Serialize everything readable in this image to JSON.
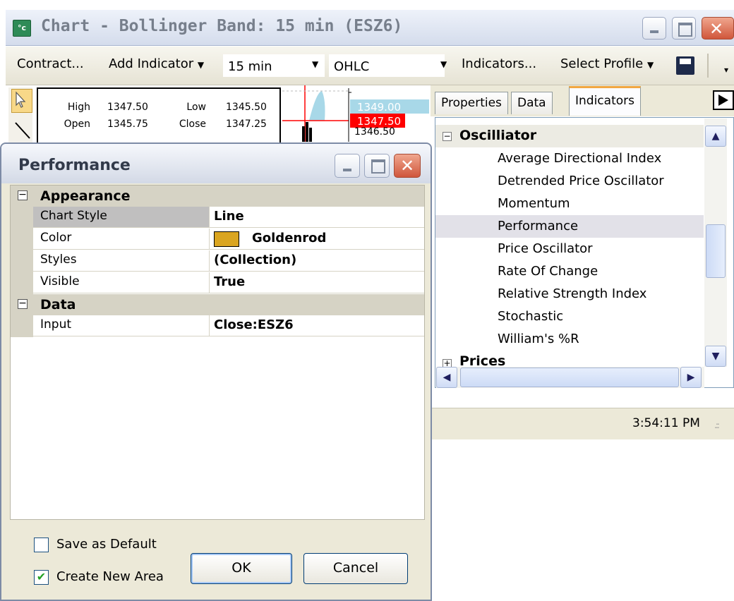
{
  "main_window": {
    "title": "Chart - Bollinger Band: 15 min (ESZ6)"
  },
  "toolbar": {
    "contract": "Contract...",
    "add_indicator": "Add Indicator",
    "interval": "15 min",
    "chart_type": "OHLC",
    "indicators": "Indicators...",
    "select_profile": "Select Profile"
  },
  "chart": {
    "info": {
      "high_label": "High",
      "high_value": "1347.50",
      "low_label": "Low",
      "low_value": "1345.50",
      "open_label": "Open",
      "open_value": "1345.75",
      "close_label": "Close",
      "close_value": "1347.25"
    },
    "price_labels": [
      "1349.00",
      "1347.50",
      "1346.50"
    ]
  },
  "side_panel": {
    "tabs": [
      "Properties",
      "Data",
      "Indicators"
    ],
    "active_tab": "Indicators",
    "groups": [
      {
        "name": "Oscilliator",
        "expanded": true,
        "items": [
          "Average Directional Index",
          "Detrended Price Oscillator",
          "Momentum",
          "Performance",
          "Price Oscillator",
          "Rate Of Change",
          "Relative Strength Index",
          "Stochastic",
          "William's %R"
        ],
        "selected": "Performance"
      },
      {
        "name": "Prices",
        "expanded": false
      }
    ]
  },
  "status_bar": {
    "time": "3:54:11 PM"
  },
  "performance_dialog": {
    "title": "Performance",
    "categories": [
      {
        "name": "Appearance",
        "properties": [
          {
            "name": "Chart Style",
            "value": "Line"
          },
          {
            "name": "Color",
            "value": "Goldenrod",
            "swatch": "#DAA520"
          },
          {
            "name": "Styles",
            "value": "(Collection)"
          },
          {
            "name": "Visible",
            "value": "True"
          }
        ]
      },
      {
        "name": "Data",
        "properties": [
          {
            "name": "Input",
            "value": "Close:ESZ6"
          }
        ]
      }
    ],
    "save_as_default": {
      "label": "Save as Default",
      "checked": false
    },
    "create_new_area": {
      "label": "Create New Area",
      "checked": true
    },
    "ok": "OK",
    "cancel": "Cancel"
  },
  "colors": {
    "accent_tab": "#F1A742",
    "swatch": "#DAA520",
    "price_highlight": "#FF0000",
    "price_bg": "#A8D8E8"
  }
}
